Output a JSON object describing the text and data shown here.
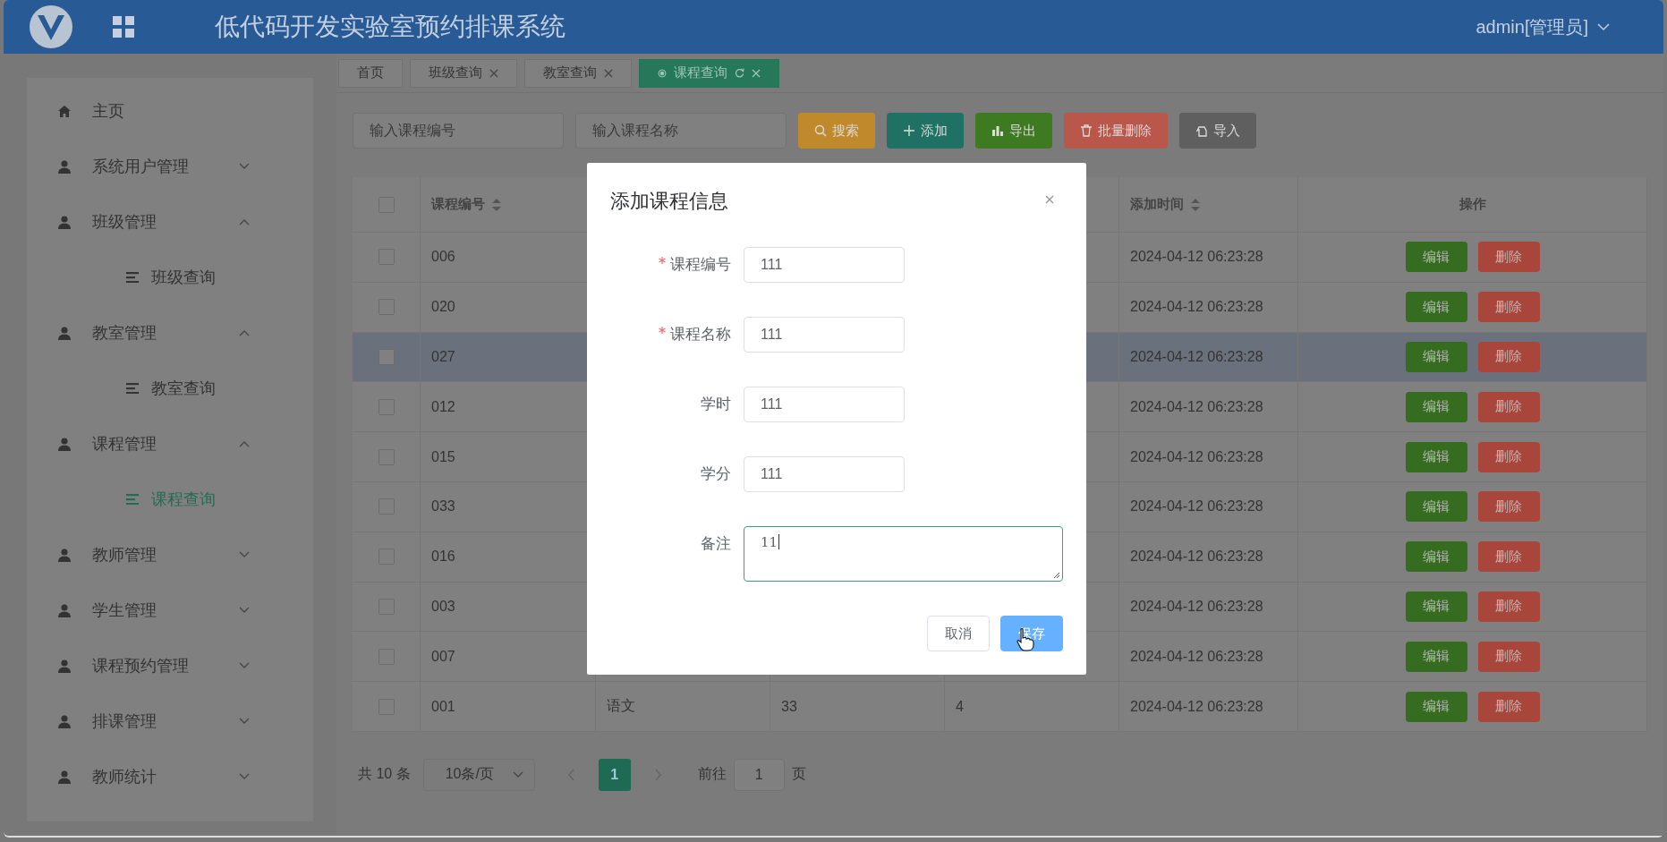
{
  "header": {
    "title": "低代码开发实验室预约排课系统",
    "user": "admin[管理员]"
  },
  "sidebar": {
    "items": [
      {
        "label": "主页",
        "kind": "home"
      },
      {
        "label": "系统用户管理",
        "kind": "group",
        "expanded": false
      },
      {
        "label": "班级管理",
        "kind": "group",
        "expanded": true,
        "children": [
          {
            "label": "班级查询",
            "selected": false
          }
        ]
      },
      {
        "label": "教室管理",
        "kind": "group",
        "expanded": true,
        "children": [
          {
            "label": "教室查询",
            "selected": false
          }
        ]
      },
      {
        "label": "课程管理",
        "kind": "group",
        "expanded": true,
        "children": [
          {
            "label": "课程查询",
            "selected": true
          }
        ]
      },
      {
        "label": "教师管理",
        "kind": "group",
        "expanded": false
      },
      {
        "label": "学生管理",
        "kind": "group",
        "expanded": false
      },
      {
        "label": "课程预约管理",
        "kind": "group",
        "expanded": false
      },
      {
        "label": "排课管理",
        "kind": "group",
        "expanded": false
      },
      {
        "label": "教师统计",
        "kind": "group",
        "expanded": false
      }
    ]
  },
  "tabs": [
    {
      "label": "首页",
      "closable": false,
      "selected": false
    },
    {
      "label": "班级查询",
      "closable": true,
      "selected": false
    },
    {
      "label": "教室查询",
      "closable": true,
      "selected": false
    },
    {
      "label": "课程查询",
      "closable": true,
      "selected": true
    }
  ],
  "toolbar": {
    "fields": [
      {
        "placeholder": "输入课程编号"
      },
      {
        "placeholder": "输入课程名称"
      }
    ],
    "buttons": [
      {
        "label": "搜索",
        "kind": "search"
      },
      {
        "label": "添加",
        "kind": "add"
      },
      {
        "label": "导出",
        "kind": "export"
      },
      {
        "label": "批量删除",
        "kind": "delete"
      },
      {
        "label": "导入",
        "kind": "import"
      }
    ]
  },
  "table": {
    "select_all_checked": false,
    "columns": [
      {
        "label": "课程编号",
        "sortable": true
      },
      {
        "label": "添加时间",
        "sortable": true
      },
      {
        "label": "操作",
        "sortable": false
      }
    ],
    "rows": [
      {
        "code": "006",
        "added": "2024-04-12 06:23:28",
        "highlighted": false,
        "checked": false,
        "actions": [
          "编辑",
          "删除"
        ]
      },
      {
        "code": "020",
        "added": "2024-04-12 06:23:28",
        "highlighted": false,
        "checked": false,
        "actions": [
          "编辑",
          "删除"
        ]
      },
      {
        "code": "027",
        "added": "2024-04-12 06:23:28",
        "highlighted": true,
        "checked": false,
        "actions": [
          "编辑",
          "删除"
        ]
      },
      {
        "code": "012",
        "added": "2024-04-12 06:23:28",
        "highlighted": false,
        "checked": false,
        "actions": [
          "编辑",
          "删除"
        ]
      },
      {
        "code": "015",
        "added": "2024-04-12 06:23:28",
        "highlighted": false,
        "checked": false,
        "actions": [
          "编辑",
          "删除"
        ]
      },
      {
        "code": "033",
        "added": "2024-04-12 06:23:28",
        "highlighted": false,
        "checked": false,
        "actions": [
          "编辑",
          "删除"
        ]
      },
      {
        "code": "016",
        "added": "2024-04-12 06:23:28",
        "highlighted": false,
        "checked": false,
        "actions": [
          "编辑",
          "删除"
        ]
      },
      {
        "code": "003",
        "added": "2024-04-12 06:23:28",
        "highlighted": false,
        "checked": false,
        "actions": [
          "编辑",
          "删除"
        ]
      },
      {
        "code": "007",
        "added": "2024-04-12 06:23:28",
        "highlighted": false,
        "checked": false,
        "actions": [
          "编辑",
          "删除"
        ]
      },
      {
        "code": "001",
        "column_3": "语文",
        "column_4": "33",
        "column_5": "4",
        "added": "2024-04-12 06:23:28",
        "highlighted": false,
        "checked": false,
        "actions": [
          "编辑",
          "删除"
        ]
      }
    ]
  },
  "pagination": {
    "total": "共 10 条",
    "page_size": "10条/页",
    "pages": [
      {
        "label": "1",
        "selected": true
      }
    ],
    "goto_label": "前往",
    "goto_value": "1",
    "goto_suffix": "页"
  },
  "dialog": {
    "title": "添加课程信息",
    "fields": [
      {
        "label": "课程编号",
        "required": true,
        "value": "111",
        "kind": "input",
        "focused": false
      },
      {
        "label": "课程名称",
        "required": true,
        "value": "111",
        "kind": "input",
        "focused": false
      },
      {
        "label": "学时",
        "required": false,
        "value": "111",
        "kind": "input",
        "focused": false
      },
      {
        "label": "学分",
        "required": false,
        "value": "111",
        "kind": "input",
        "focused": false
      },
      {
        "label": "备注",
        "required": false,
        "value": "11",
        "kind": "textarea",
        "focused": true
      }
    ],
    "buttons": [
      {
        "label": "取消",
        "kind": "cancel"
      },
      {
        "label": "保存",
        "kind": "primary"
      }
    ]
  }
}
